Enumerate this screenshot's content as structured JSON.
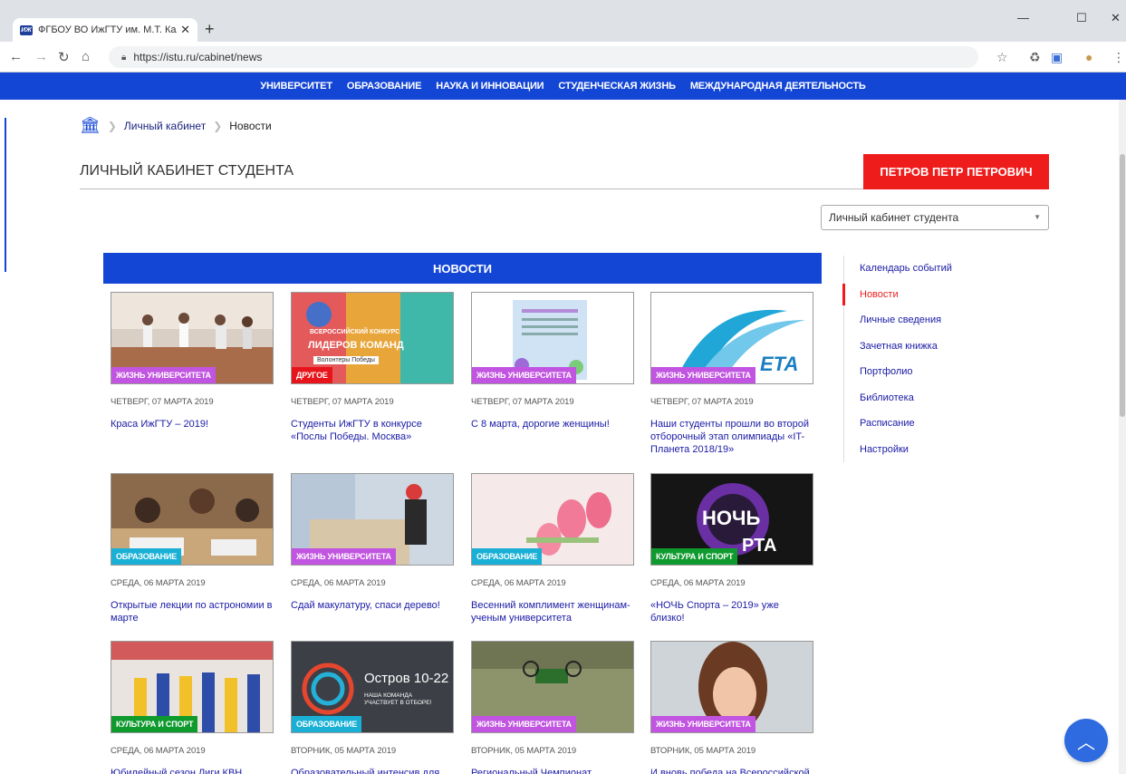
{
  "browser": {
    "tab_title": "ФГБОУ ВО ИжГТУ им. М.Т. Калашникова",
    "favicon_text": "ИЖ",
    "url": "https://istu.ru/cabinet/news"
  },
  "site_nav": [
    "УНИВЕРСИТЕТ",
    "ОБРАЗОВАНИЕ",
    "НАУКА И ИННОВАЦИИ",
    "СТУДЕНЧЕСКАЯ ЖИЗНЬ",
    "МЕЖДУНАРОДНАЯ ДЕЯТЕЛЬНОСТЬ"
  ],
  "breadcrumb": {
    "link": "Личный кабинет",
    "current": "Новости"
  },
  "page": {
    "title": "ЛИЧНЫЙ КАБИНЕТ СТУДЕНТА",
    "user": "ПЕТРОВ ПЕТР ПЕТРОВИЧ",
    "select_value": "Личный кабинет студента",
    "news_header": "НОВОСТИ"
  },
  "colors": {
    "zhizn": "#c154e0",
    "drugoe": "#e8141b",
    "obrazovanie": "#1ab0d6",
    "kultura": "#0f9a2e"
  },
  "cards": [
    {
      "badge": "ЖИЗНЬ УНИВЕРСИТЕТА",
      "badge_color": "#c154e0",
      "date": "ЧЕТВЕРГ, 07 МАРТА 2019",
      "title": "Краса ИжГТУ – 2019!",
      "img": "dance"
    },
    {
      "badge": "ДРУГОЕ",
      "badge_color": "#e8141b",
      "date": "ЧЕТВЕРГ, 07 МАРТА 2019",
      "title": "Студенты ИжГТУ в конкурсе «Послы Победы. Москва»",
      "img": "leaders",
      "img_text_1": "ВСЕРОССИЙСКИЙ КОНКУРС",
      "img_text_2": "ЛИДЕРОВ КОМАНД",
      "img_text_3": "Волонтеры Победы"
    },
    {
      "badge": "ЖИЗНЬ УНИВЕРСИТЕТА",
      "badge_color": "#c154e0",
      "date": "ЧЕТВЕРГ, 07 МАРТА 2019",
      "title": "С 8 марта, дорогие женщины!",
      "img": "card8"
    },
    {
      "badge": "ЖИЗНЬ УНИВЕРСИТЕТА",
      "badge_color": "#c154e0",
      "date": "ЧЕТВЕРГ, 07 МАРТА 2019",
      "title": "Наши студенты прошли во второй отборочный этап олимпиады «IT-Планета 2018/19»",
      "img": "itplanet",
      "img_text_1": "ETA"
    },
    {
      "badge": "ОБРАЗОВАНИЕ",
      "badge_color": "#1ab0d6",
      "date": "СРЕДА, 06 МАРТА 2019",
      "title": "Открытые лекции по астрономии в марте",
      "img": "students"
    },
    {
      "badge": "ЖИЗНЬ УНИВЕРСИТЕТА",
      "badge_color": "#c154e0",
      "date": "СРЕДА, 06 МАРТА 2019",
      "title": "Сдай макулатуру, спаси дерево!",
      "img": "paper"
    },
    {
      "badge": "ОБРАЗОВАНИЕ",
      "badge_color": "#1ab0d6",
      "date": "СРЕДА, 06 МАРТА 2019",
      "title": "Весенний комплимент женщинам-ученым университета",
      "img": "tulips"
    },
    {
      "badge": "КУЛЬТУРА И СПОРТ",
      "badge_color": "#0f9a2e",
      "date": "СРЕДА, 06 МАРТА 2019",
      "title": "«НОЧЬ Спорта – 2019» уже близко!",
      "img": "night",
      "img_text_1": "НОЧЬ",
      "img_text_2": "РТА"
    },
    {
      "badge": "КУЛЬТУРА И СПОРТ",
      "badge_color": "#0f9a2e",
      "date": "СРЕДА, 06 МАРТА 2019",
      "title": "Юбилейный сезон Лиги КВН",
      "img": "kvn"
    },
    {
      "badge": "ОБРАЗОВАНИЕ",
      "badge_color": "#1ab0d6",
      "date": "ВТОРНИК, 05 МАРТА 2019",
      "title": "Образовательный интенсив для",
      "img": "ostrov",
      "img_text_1": "Остров 10-22",
      "img_text_2": "НАША КОМАНДА",
      "img_text_3": "УЧАСТВУЕТ В ОТБОРЕ!"
    },
    {
      "badge": "ЖИЗНЬ УНИВЕРСИТЕТА",
      "badge_color": "#c154e0",
      "date": "ВТОРНИК, 05 МАРТА 2019",
      "title": "Региональный Чемпионат",
      "img": "drone"
    },
    {
      "badge": "ЖИЗНЬ УНИВЕРСИТЕТА",
      "badge_color": "#c154e0",
      "date": "ВТОРНИК, 05 МАРТА 2019",
      "title": "И вновь победа на Всероссийской",
      "img": "woman"
    }
  ],
  "sidenav": [
    {
      "label": "Календарь событий",
      "active": false
    },
    {
      "label": "Новости",
      "active": true
    },
    {
      "label": "Личные сведения",
      "active": false
    },
    {
      "label": "Зачетная книжка",
      "active": false
    },
    {
      "label": "Портфолио",
      "active": false
    },
    {
      "label": "Библиотека",
      "active": false
    },
    {
      "label": "Расписание",
      "active": false
    },
    {
      "label": "Настройки",
      "active": false
    }
  ]
}
